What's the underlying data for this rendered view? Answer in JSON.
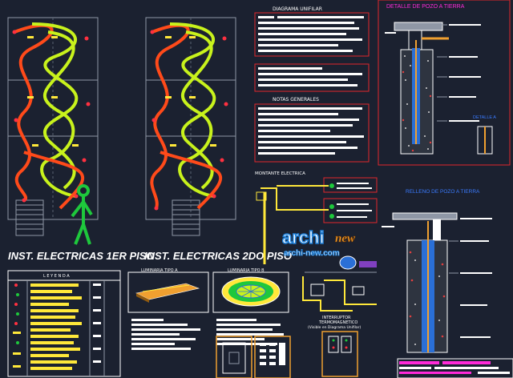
{
  "plan_titles": {
    "floor1": "INST. ELECTRICAS 1ER PISO",
    "floor2": "INST. ELECTRICAS 2DO PISO"
  },
  "sections": {
    "unifilar": "DIAGRAMA UNIFILAR",
    "notas": "NOTAS GENERALES",
    "montante": "MONTANTE ELECTRICA",
    "pozo": "DETALLE DE POZO A TIERRA",
    "relleno": "RELLENO DE POZO A TIERRA",
    "detalle_a": "DETALLE A",
    "leyenda": "L E Y E N D A",
    "luminaria_a": "LUMINARIA TIPO A",
    "luminaria_b": "LUMINARIA TIPO B",
    "interruptor_1": "INTERRUPTOR",
    "interruptor_2": "TERMOMAGNETICO",
    "interruptor_3": "(Visible en Diagrama Unifilar)"
  },
  "watermark": {
    "brand": "archi",
    "new": "new",
    "url": "archi-new.com"
  },
  "colors": {
    "background": "#1b2130",
    "circuit_orange": "#ff4a1a",
    "circuit_green": "#c8f21c",
    "text_block": "#ffffff",
    "frame_red": "#e0262c",
    "frame_blue": "#3a6bff",
    "figure_green": "#1ec83c",
    "title_magenta": "#ff2ad8",
    "title_blue": "#3a7bff"
  }
}
